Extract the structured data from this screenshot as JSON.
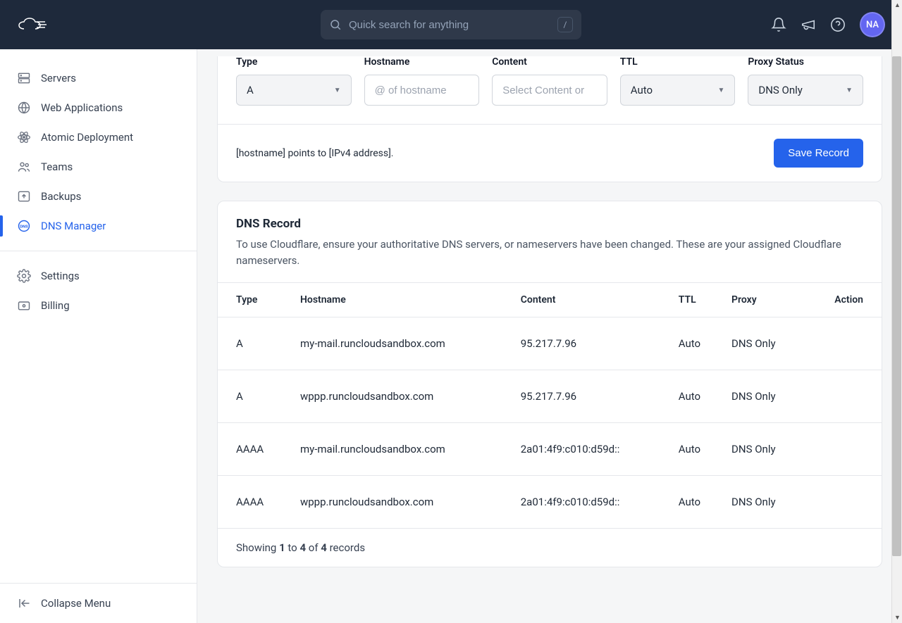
{
  "header": {
    "search_placeholder": "Quick search for anything",
    "search_shortcut": "/",
    "avatar_initials": "NA"
  },
  "sidebar": {
    "items": [
      {
        "label": "Servers",
        "icon": "server-icon"
      },
      {
        "label": "Web Applications",
        "icon": "globe-icon"
      },
      {
        "label": "Atomic Deployment",
        "icon": "atom-icon"
      },
      {
        "label": "Teams",
        "icon": "users-icon"
      },
      {
        "label": "Backups",
        "icon": "backup-icon"
      },
      {
        "label": "DNS Manager",
        "icon": "dns-icon",
        "active": true
      }
    ],
    "items2": [
      {
        "label": "Settings",
        "icon": "gear-icon"
      },
      {
        "label": "Billing",
        "icon": "billing-icon"
      }
    ],
    "collapse_label": "Collapse Menu"
  },
  "form": {
    "type_label": "Type",
    "type_value": "A",
    "hostname_label": "Hostname",
    "hostname_placeholder": "@ of hostname",
    "content_label": "Content",
    "content_placeholder": "Select Content or",
    "ttl_label": "TTL",
    "ttl_value": "Auto",
    "proxy_label": "Proxy Status",
    "proxy_value": "DNS Only",
    "hint": "[hostname] points to [IPv4 address].",
    "save_button": "Save Record"
  },
  "records": {
    "title": "DNS Record",
    "description": "To use Cloudflare, ensure your authoritative DNS servers, or nameservers have been changed. These are your assigned Cloudflare nameservers.",
    "columns": {
      "type": "Type",
      "hostname": "Hostname",
      "content": "Content",
      "ttl": "TTL",
      "proxy": "Proxy",
      "action": "Action"
    },
    "rows": [
      {
        "type": "A",
        "hostname": "my-mail.runcloudsandbox.com",
        "content": "95.217.7.96",
        "ttl": "Auto",
        "proxy": "DNS Only"
      },
      {
        "type": "A",
        "hostname": "wppp.runcloudsandbox.com",
        "content": "95.217.7.96",
        "ttl": "Auto",
        "proxy": "DNS Only"
      },
      {
        "type": "AAAA",
        "hostname": "my-mail.runcloudsandbox.com",
        "content": "2a01:4f9:c010:d59d::",
        "ttl": "Auto",
        "proxy": "DNS Only"
      },
      {
        "type": "AAAA",
        "hostname": "wppp.runcloudsandbox.com",
        "content": "2a01:4f9:c010:d59d::",
        "ttl": "Auto",
        "proxy": "DNS Only"
      }
    ],
    "footer": {
      "prefix": "Showing ",
      "from": "1",
      "to_word": " to ",
      "to": "4",
      "of_word": " of ",
      "total": "4",
      "suffix": " records"
    }
  }
}
